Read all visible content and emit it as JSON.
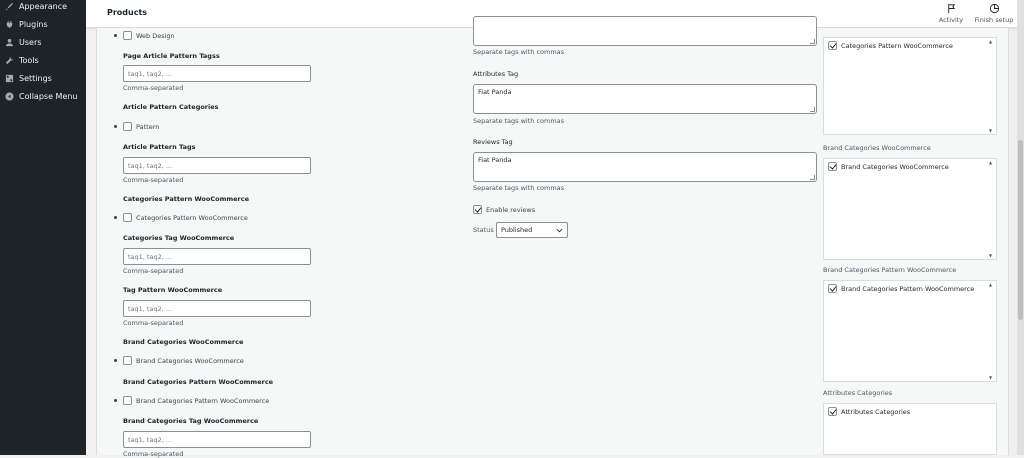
{
  "sidebar": {
    "items": [
      {
        "label": "Appearance",
        "icon": "appearance-icon"
      },
      {
        "label": "Plugins",
        "icon": "plugins-icon"
      },
      {
        "label": "Users",
        "icon": "users-icon"
      },
      {
        "label": "Tools",
        "icon": "tools-icon"
      },
      {
        "label": "Settings",
        "icon": "settings-icon"
      },
      {
        "label": "Collapse Menu",
        "icon": "collapse-icon"
      }
    ]
  },
  "header": {
    "title": "Products",
    "activity_label": "Activity",
    "finish_setup_label": "Finish setup"
  },
  "left_column": {
    "web_design_label": "Web Design",
    "page_article_pattern_tags": {
      "label": "Page Article Pattern Tagss",
      "placeholder": "taq1, taq2, ...",
      "hint": "Comma-separated"
    },
    "article_pattern_categories": {
      "label": "Article Pattern Categories",
      "option": "Pattern"
    },
    "article_pattern_tags": {
      "label": "Article Pattern Tags",
      "placeholder": "taq1, taq2, ...",
      "hint": "Comma-separated"
    },
    "categories_pattern_woo": {
      "label": "Categories Pattern WooCommerce",
      "option": "Categories Pattern WooCommerce"
    },
    "categories_tag_woo": {
      "label": "Categories Tag WooCommerce",
      "placeholder": "taq1, taq2, ...",
      "hint": "Comma-separated"
    },
    "tag_pattern_woo": {
      "label": "Tag Pattern WooCommerce",
      "placeholder": "taq1, taq2, ...",
      "hint": "Comma-separated"
    },
    "brand_categories_woo": {
      "label": "Brand Categories WooCommerce",
      "option": "Brand Categories WooCommerce"
    },
    "brand_categories_pattern_woo": {
      "label": "Brand Categories Pattern WooCommerce",
      "option": "Brand Categories Pattern WooCommerce"
    },
    "brand_categories_tag_woo": {
      "label": "Brand Categories Tag WooCommerce",
      "placeholder": "taq1, taq2, ...",
      "hint": "Comma-separated"
    }
  },
  "middle_column": {
    "top_hint": "Separate tags with commas",
    "attributes_tag": {
      "label": "Attributes Tag",
      "value": "Fiat Panda",
      "hint": "Separate tags with commas"
    },
    "reviews_tag": {
      "label": "Reviews Tag",
      "value": "Fiat Panda",
      "hint": "Separate tags with commas"
    },
    "enable_reviews_label": "Enable reviews",
    "status_label": "Status",
    "status_value": "Published"
  },
  "right_column": {
    "box1_item": "Categories Pattern WooCommerce",
    "brand_categories": {
      "label": "Brand Categories WooCommerce",
      "item": "Brand Categories WooCommerce"
    },
    "brand_categories_pattern": {
      "label": "Brand Categories Pattern WooCommerce",
      "item": "Brand Categories Pattern WooCommerce"
    },
    "attributes_categories": {
      "label": "Attributes Categories",
      "item": "Attributes Categories"
    }
  },
  "colors": {
    "sidebar_bg": "#1d2327",
    "panel_bg": "#f6f7f7",
    "border": "#8c8f94"
  }
}
